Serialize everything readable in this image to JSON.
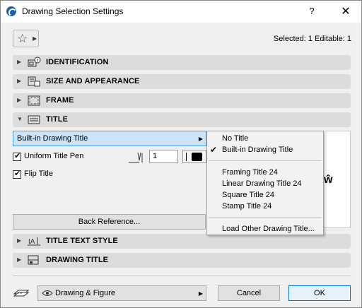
{
  "window": {
    "title": "Drawing Selection Settings",
    "help": "?",
    "close": "✕"
  },
  "toolbar": {
    "favorites_icon": "star-icon",
    "selected_info": "Selected: 1 Editable: 1"
  },
  "panels": [
    {
      "label": "IDENTIFICATION",
      "expanded": false,
      "icon": "identification-icon"
    },
    {
      "label": "SIZE AND APPEARANCE",
      "expanded": false,
      "icon": "size-appearance-icon"
    },
    {
      "label": "FRAME",
      "expanded": false,
      "icon": "frame-icon"
    },
    {
      "label": "TITLE",
      "expanded": true,
      "icon": "title-icon"
    },
    {
      "label": "TITLE TEXT STYLE",
      "expanded": false,
      "icon": "title-text-style-icon"
    },
    {
      "label": "DRAWING TITLE",
      "expanded": false,
      "icon": "drawing-title-icon"
    }
  ],
  "title_panel": {
    "title_type_value": "Built-in Drawing Title",
    "uniform_title_pen_label": "Uniform Title Pen",
    "uniform_title_pen_checked": true,
    "pen_number": "1",
    "pen_color": "#000000",
    "flip_title_label": "Flip Title",
    "flip_title_checked": true,
    "back_reference_button": "Back Reference...",
    "preview_glyph": "ŵ"
  },
  "title_menu": {
    "items": [
      "No Title",
      "Built-in Drawing Title",
      "Framing Title 24",
      "Linear Drawing Title 24",
      "Square Title 24",
      "Stamp Title 24",
      "Load Other Drawing Title..."
    ],
    "checked_item": "Built-in Drawing Title",
    "check_glyph": "✔"
  },
  "footer": {
    "view_option": "Drawing & Figure",
    "cancel_label": "Cancel",
    "ok_label": "OK"
  }
}
